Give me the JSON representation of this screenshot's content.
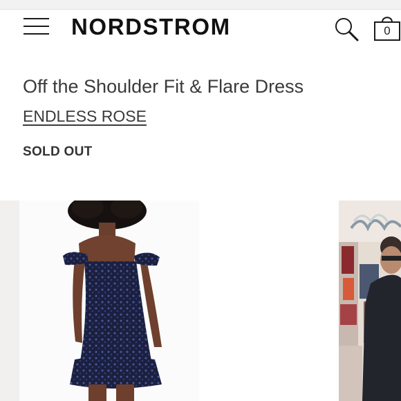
{
  "header": {
    "logo": "NORDSTROM",
    "cart_count": "0"
  },
  "product": {
    "title": "Off the Shoulder Fit & Flare Dress",
    "brand": "ENDLESS ROSE",
    "status": "SOLD OUT"
  },
  "icons": {
    "menu": "hamburger-menu-icon",
    "search": "search-icon",
    "bag": "shopping-bag-icon"
  },
  "colors": {
    "dress": "#1c2040",
    "sequin": "#4a5a9a",
    "text": "#3a3a3a"
  }
}
